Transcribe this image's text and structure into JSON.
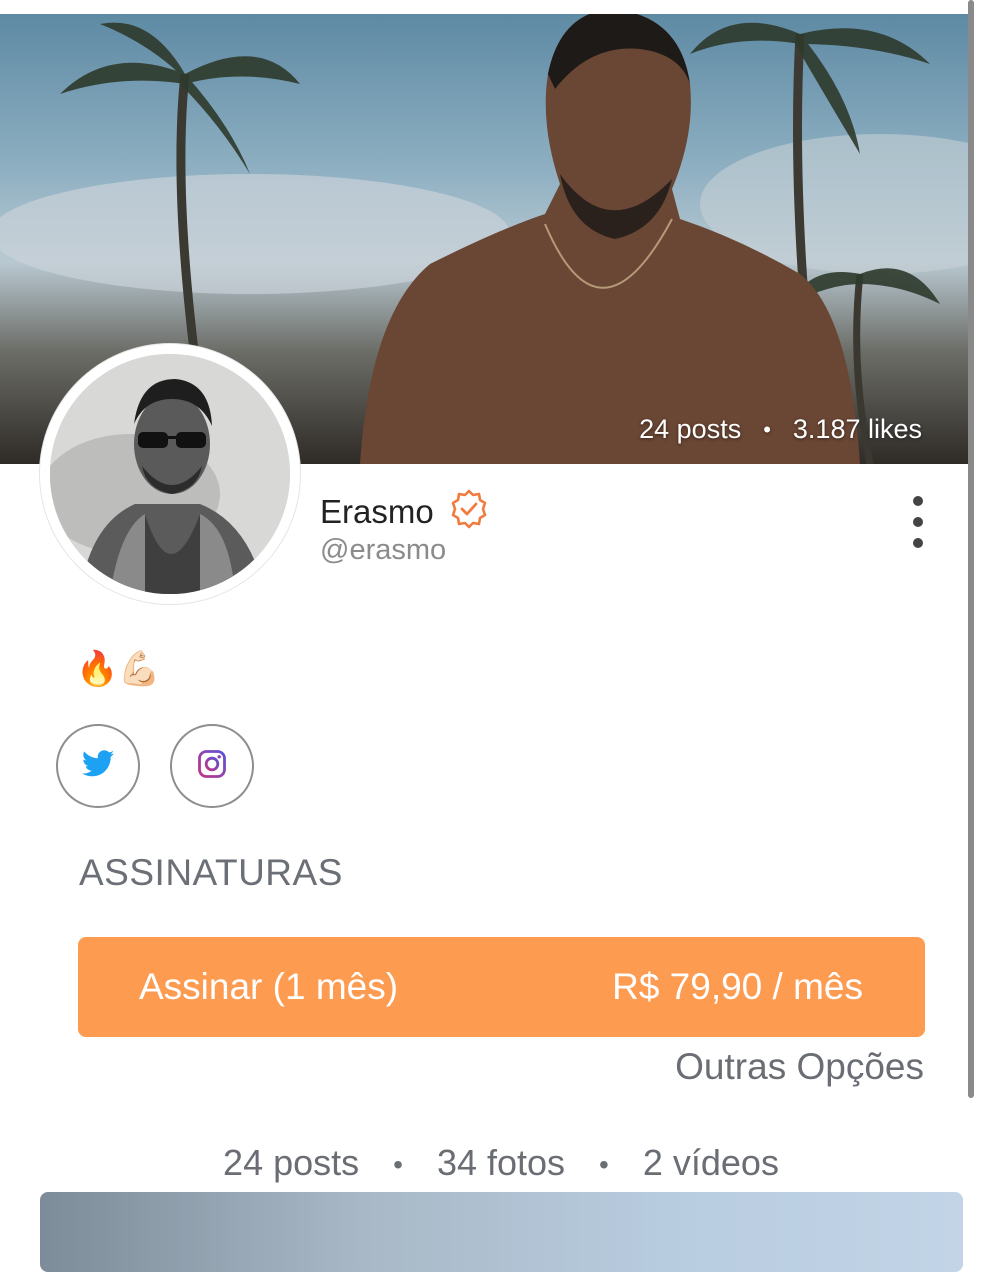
{
  "cover": {
    "posts": "24 posts",
    "separator": "•",
    "likes": "3.187 likes"
  },
  "profile": {
    "name": "Erasmo",
    "handle": "@erasmo",
    "verified_icon": "verified-badge-icon",
    "verified_color": "#f07b3f",
    "bio_emoji": "🔥💪🏻"
  },
  "social": {
    "twitter_icon": "twitter-icon",
    "twitter_color": "#1da1f2",
    "instagram_icon": "instagram-icon",
    "instagram_color": "#8e3bbd"
  },
  "subscriptions": {
    "title": "ASSINATURAS",
    "button_label": "Assinar (1 mês)",
    "button_price": "R$ 79,90 / mês",
    "button_color": "#fd9b51",
    "other_options": "Outras Opções"
  },
  "counts": {
    "posts": "24 posts",
    "photos": "34 fotos",
    "videos": "2 vídeos",
    "separator": "•"
  }
}
